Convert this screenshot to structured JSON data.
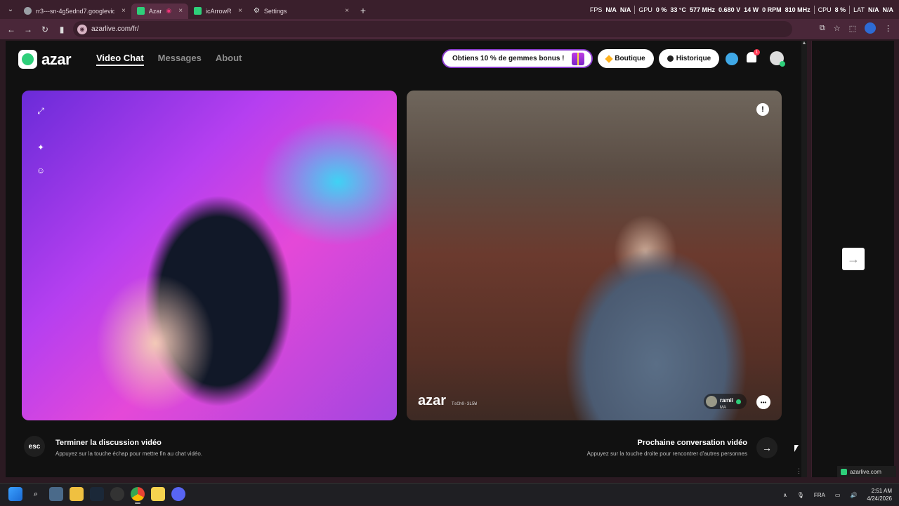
{
  "browser": {
    "tabs": [
      {
        "title": "rr3---sn-4g5ednd7.googlevide",
        "favicon_color": "#9aa0a6",
        "active": false
      },
      {
        "title": "Azar",
        "favicon_color": "#2ecf7a",
        "active": true
      },
      {
        "title": "icArrowR",
        "favicon_color": "#2ecf7a",
        "active": false
      },
      {
        "title": "Settings",
        "favicon_color": "#cfc3c9",
        "active": false
      }
    ],
    "url": "azarlive.com/fr/",
    "new_tab": "+",
    "tab_close": "×"
  },
  "hardware_overlay": {
    "fps_label": "FPS",
    "fps_val1": "N/A",
    "fps_val2": "N/A",
    "gpu_label": "GPU",
    "gpu_load": "0 %",
    "gpu_temp": "33 °C",
    "gpu_clock": "577 MHz",
    "gpu_volt": "0.680 V",
    "gpu_power": "14 W",
    "gpu_fan": "0 RPM",
    "gpu_mem": "810 MHz",
    "cpu_label": "CPU",
    "cpu_load": "8 %",
    "lat_label": "LAT",
    "lat_val1": "N/A",
    "lat_val2": "N/A"
  },
  "site": {
    "logo": "azar",
    "nav": [
      {
        "label": "Video Chat",
        "active": true
      },
      {
        "label": "Messages",
        "active": false
      },
      {
        "label": "About",
        "active": false
      }
    ],
    "promo": "Obtiens 10 % de gemmes bonus !",
    "boutique": "Boutique",
    "historique": "Historique",
    "notif_count": "1",
    "icons": {
      "expand": "expand-icon",
      "magic": "magic-wand-icon",
      "sticker": "sticker-icon",
      "report": "report-icon",
      "message": "chat-bubble-icon"
    },
    "accent": "#2ecf7a",
    "promo_border": "#8b3ccf"
  },
  "video": {
    "report_symbol": "!",
    "watermark": "azar",
    "watermark_code": "TsCh0-3L5W",
    "partner_name": "ramii",
    "partner_country": "MA"
  },
  "actions": {
    "esc_label": "esc",
    "end_title": "Terminer la discussion vidéo",
    "end_sub": "Appuyez sur la touche échap pour mettre fin au chat vidéo.",
    "next_title": "Prochaine conversation vidéo",
    "next_sub": "Appuyez sur la touche droite pour rencontrer d'autres personnes",
    "next_arrow": "→"
  },
  "side_panel": {
    "arrow": "→",
    "footer": "azarlive.com"
  },
  "taskbar": {
    "lang": "FRA",
    "time": "2:51 AM",
    "date": "4/24/2026"
  }
}
